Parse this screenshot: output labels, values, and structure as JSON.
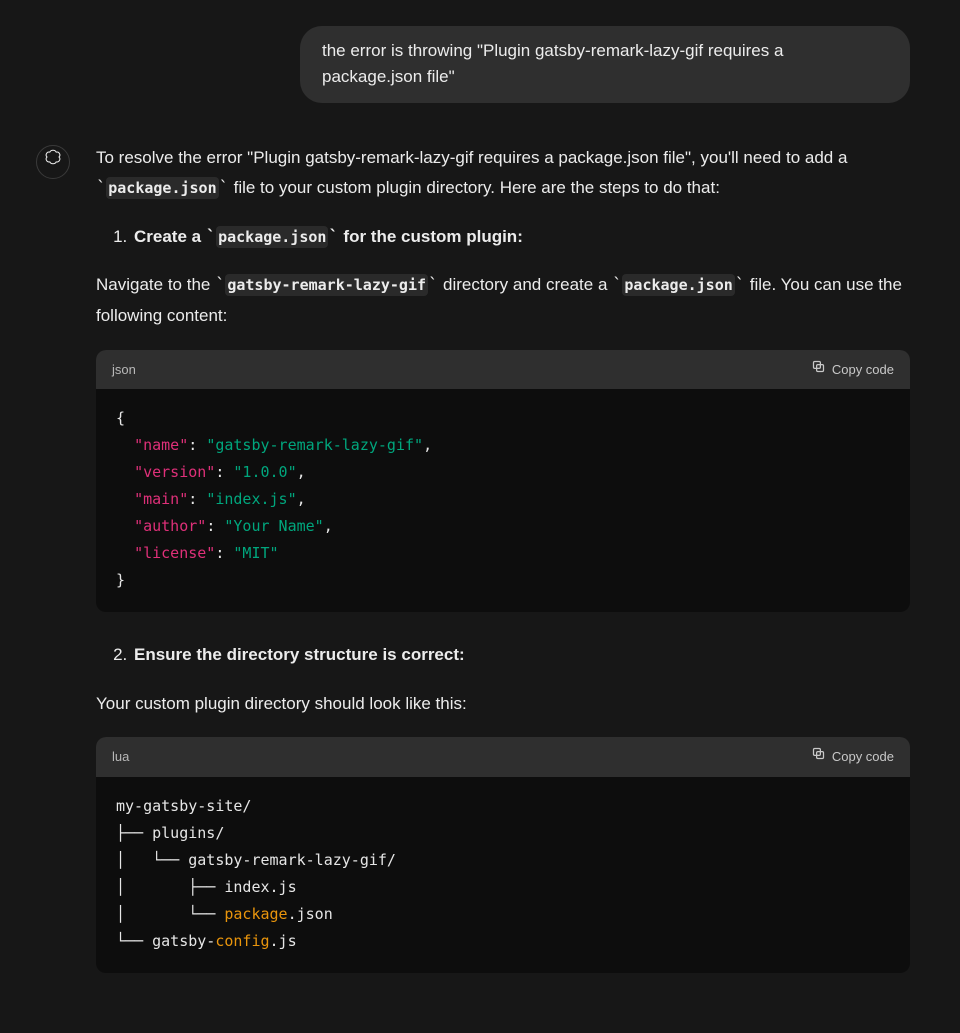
{
  "user_message": "the error is throwing \"Plugin gatsby-remark-lazy-gif requires a package.json file\"",
  "assistant": {
    "intro_pre": "To resolve the error \"Plugin gatsby-remark-lazy-gif requires a package.json file\", you'll need to add a ",
    "intro_code": "package.json",
    "intro_post": " file to your custom plugin directory. Here are the steps to do that:",
    "step1_pre": "Create a ",
    "step1_code": "package.json",
    "step1_post": " for the custom plugin:",
    "nav_pre": "Navigate to the ",
    "nav_code1": "gatsby-remark-lazy-gif",
    "nav_mid": " directory and create a ",
    "nav_code2": "package.json",
    "nav_post": " file. You can use the following content:",
    "step2": "Ensure the directory structure is correct:",
    "dirline": "Your custom plugin directory should look like this:"
  },
  "code1": {
    "lang": "json",
    "copy": "Copy code",
    "tokens": {
      "open": "{",
      "k_name": "\"name\"",
      "v_name": "\"gatsby-remark-lazy-gif\"",
      "k_version": "\"version\"",
      "v_version": "\"1.0.0\"",
      "k_main": "\"main\"",
      "v_main": "\"index.js\"",
      "k_author": "\"author\"",
      "v_author": "\"Your Name\"",
      "k_license": "\"license\"",
      "v_license": "\"MIT\"",
      "colon": ":",
      "comma": ",",
      "close": "}"
    }
  },
  "code2": {
    "lang": "lua",
    "copy": "Copy code",
    "tokens": {
      "l1": "my-gatsby-site/",
      "l2": "├── plugins/",
      "l3": "│   └── gatsby-remark-lazy-gif/",
      "l4": "│       ├── index.js",
      "l5a": "│       └── ",
      "l5b": "package",
      "l5c": ".json",
      "l6a": "└── gatsby-",
      "l6b": "config",
      "l6c": ".js"
    }
  }
}
